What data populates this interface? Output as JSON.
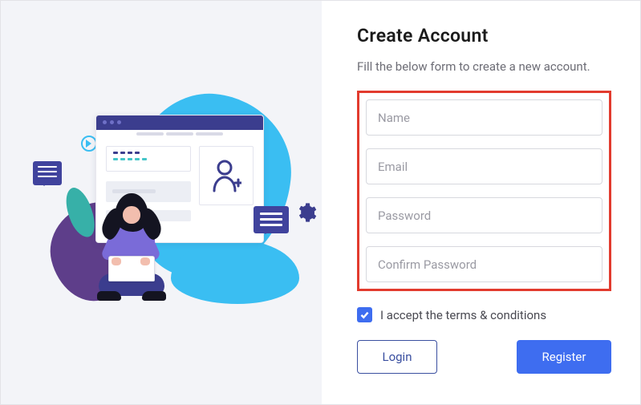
{
  "colors": {
    "accent": "#3e6df0",
    "outline": "#e23b2e",
    "navy": "#3b3d8e",
    "cyan": "#3abef2"
  },
  "header": {
    "title": "Create Account",
    "subtitle": "Fill the below form to create a new account."
  },
  "fields": {
    "name": {
      "placeholder": "Name",
      "value": ""
    },
    "email": {
      "placeholder": "Email",
      "value": ""
    },
    "pass": {
      "placeholder": "Password",
      "value": ""
    },
    "confirm": {
      "placeholder": "Confirm Password",
      "value": ""
    }
  },
  "terms": {
    "checked": true,
    "label": "I accept the terms & conditions"
  },
  "buttons": {
    "login": "Login",
    "register": "Register"
  },
  "annotation": {
    "arrow_target": "register-button"
  }
}
